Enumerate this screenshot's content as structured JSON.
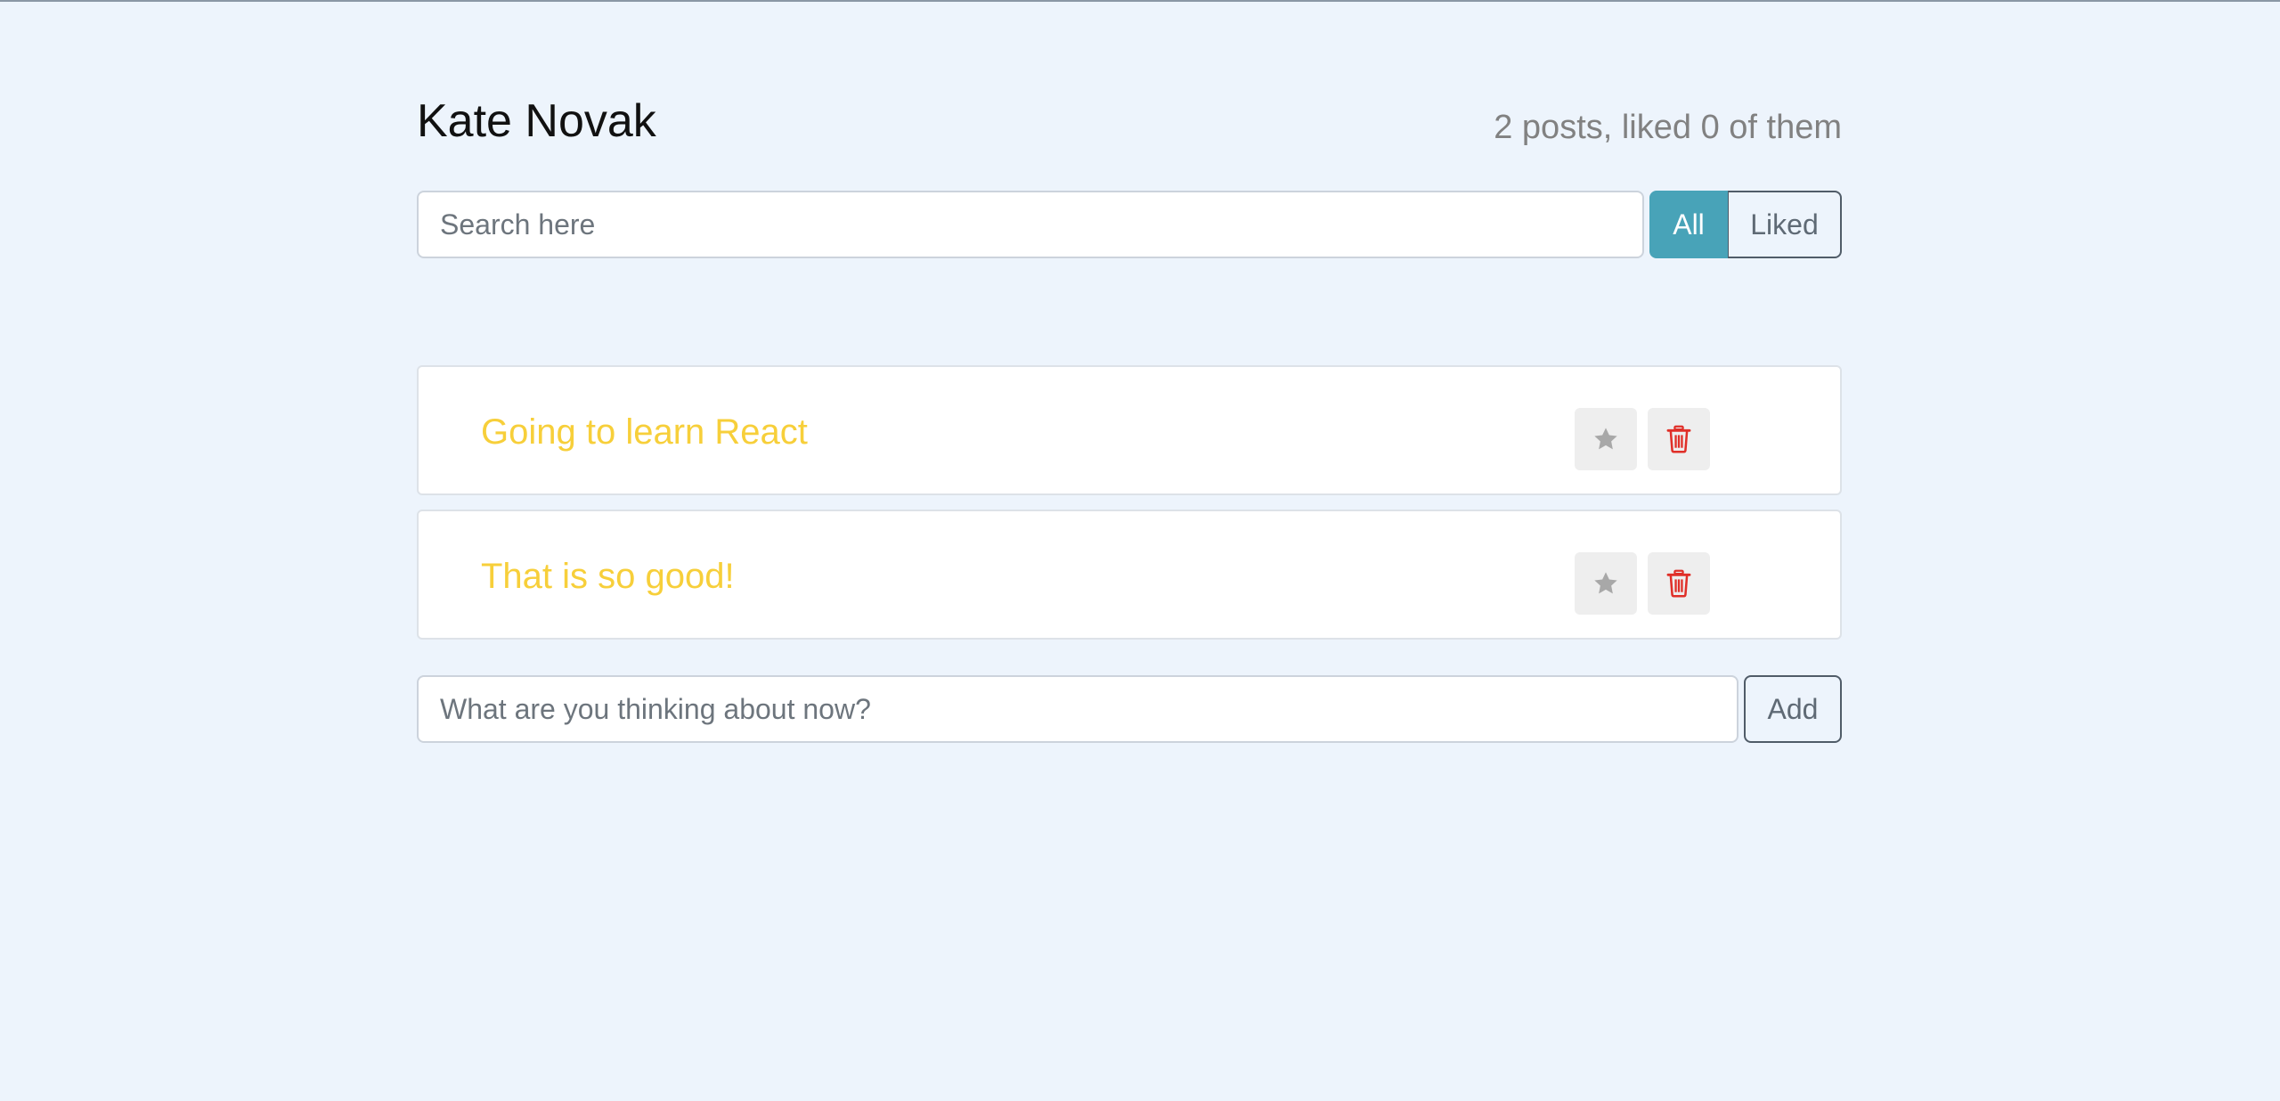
{
  "header": {
    "title": "Kate Novak",
    "stats": "2 posts, liked 0 of them"
  },
  "search": {
    "placeholder": "Search here",
    "value": ""
  },
  "filters": {
    "all_label": "All",
    "liked_label": "Liked",
    "selected": "All"
  },
  "posts": [
    {
      "label": "Going to learn React",
      "star_icon": "star-icon",
      "delete_icon": "trash-icon"
    },
    {
      "label": "That is so good!",
      "star_icon": "star-icon",
      "delete_icon": "trash-icon"
    }
  ],
  "add_form": {
    "placeholder": "What are you thinking about now?",
    "value": "",
    "button_label": "Add"
  },
  "colors": {
    "background": "#edf4fc",
    "accent": "#48a3b8",
    "post_text": "#f7cf3a",
    "delete_icon": "#e02f28",
    "star_icon": "#a8a8a8"
  }
}
